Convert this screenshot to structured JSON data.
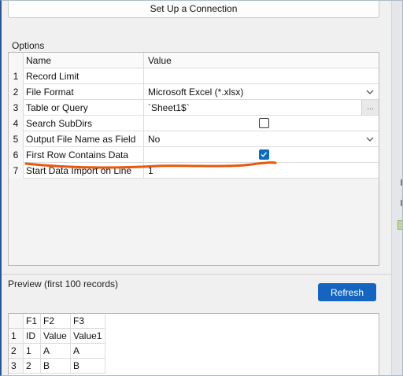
{
  "setup": {
    "button_label": "Set Up a Connection"
  },
  "options": {
    "section_title": "Options",
    "header": {
      "name": "Name",
      "value": "Value"
    },
    "rows": [
      {
        "num": "1",
        "name": "Record Limit",
        "value": ""
      },
      {
        "num": "2",
        "name": "File Format",
        "value": "Microsoft Excel (*.xlsx)"
      },
      {
        "num": "3",
        "name": "Table or Query",
        "value": "`Sheet1$`",
        "browse": "..."
      },
      {
        "num": "4",
        "name": "Search SubDirs",
        "checked": false
      },
      {
        "num": "5",
        "name": "Output File Name as Field",
        "value": "No"
      },
      {
        "num": "6",
        "name": "First Row Contains Data",
        "checked": true
      },
      {
        "num": "7",
        "name": "Start Data Import on Line",
        "value": "1"
      }
    ]
  },
  "preview": {
    "title": "Preview (first 100 records)",
    "refresh_label": "Refresh",
    "columns": [
      "F1",
      "F2",
      "F3"
    ],
    "rows": [
      {
        "num": "1",
        "cells": [
          "ID",
          "Value",
          "Value1"
        ]
      },
      {
        "num": "2",
        "cells": [
          "1",
          "A",
          "A"
        ]
      },
      {
        "num": "3",
        "cells": [
          "2",
          "B",
          "B"
        ]
      }
    ]
  },
  "colors": {
    "accent": "#1565c0",
    "checkbox_checked": "#0f6cbd",
    "annotation": "#e8570c"
  },
  "icons": {
    "dropdown": "chevron-down-icon",
    "check": "checkmark-icon"
  }
}
